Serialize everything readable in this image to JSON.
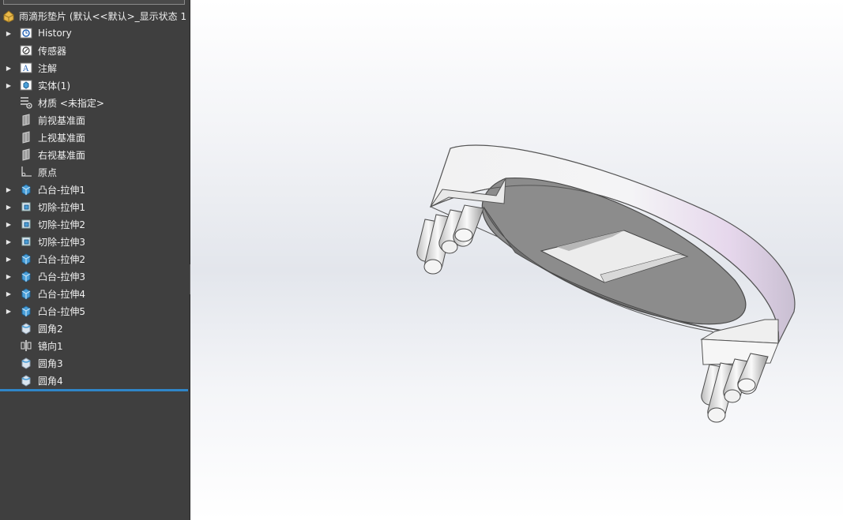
{
  "tree": {
    "root_label": "雨滴形垫片 (默认<<默认>_显示状态 1",
    "items": [
      {
        "label": "History",
        "icon": "history-icon",
        "expandable": true
      },
      {
        "label": "传感器",
        "icon": "sensor-icon",
        "expandable": false
      },
      {
        "label": "注解",
        "icon": "annotation-icon",
        "expandable": true
      },
      {
        "label": "实体(1)",
        "icon": "solid-body-icon",
        "expandable": true
      },
      {
        "label": "材质 <未指定>",
        "icon": "material-icon",
        "expandable": false
      },
      {
        "label": "前视基准面",
        "icon": "plane-icon",
        "expandable": false
      },
      {
        "label": "上视基准面",
        "icon": "plane-icon",
        "expandable": false
      },
      {
        "label": "右视基准面",
        "icon": "plane-icon",
        "expandable": false
      },
      {
        "label": "原点",
        "icon": "origin-icon",
        "expandable": false
      },
      {
        "label": "凸台-拉伸1",
        "icon": "boss-extrude-icon",
        "expandable": true
      },
      {
        "label": "切除-拉伸1",
        "icon": "cut-extrude-icon",
        "expandable": true
      },
      {
        "label": "切除-拉伸2",
        "icon": "cut-extrude-icon",
        "expandable": true
      },
      {
        "label": "切除-拉伸3",
        "icon": "cut-extrude-icon",
        "expandable": true
      },
      {
        "label": "凸台-拉伸2",
        "icon": "boss-extrude-icon",
        "expandable": true
      },
      {
        "label": "凸台-拉伸3",
        "icon": "boss-extrude-icon",
        "expandable": true
      },
      {
        "label": "凸台-拉伸4",
        "icon": "boss-extrude-icon",
        "expandable": true
      },
      {
        "label": "凸台-拉伸5",
        "icon": "boss-extrude-icon",
        "expandable": true
      },
      {
        "label": "圆角2",
        "icon": "fillet-icon",
        "expandable": false
      },
      {
        "label": "镜向1",
        "icon": "mirror-icon",
        "expandable": false
      },
      {
        "label": "圆角3",
        "icon": "fillet-icon",
        "expandable": false
      },
      {
        "label": "圆角4",
        "icon": "fillet-icon",
        "expandable": false
      }
    ]
  },
  "colors": {
    "panel_bg": "#3f3f3f",
    "accent": "#2f86c8",
    "icon_blue": "#4a9fd8"
  }
}
